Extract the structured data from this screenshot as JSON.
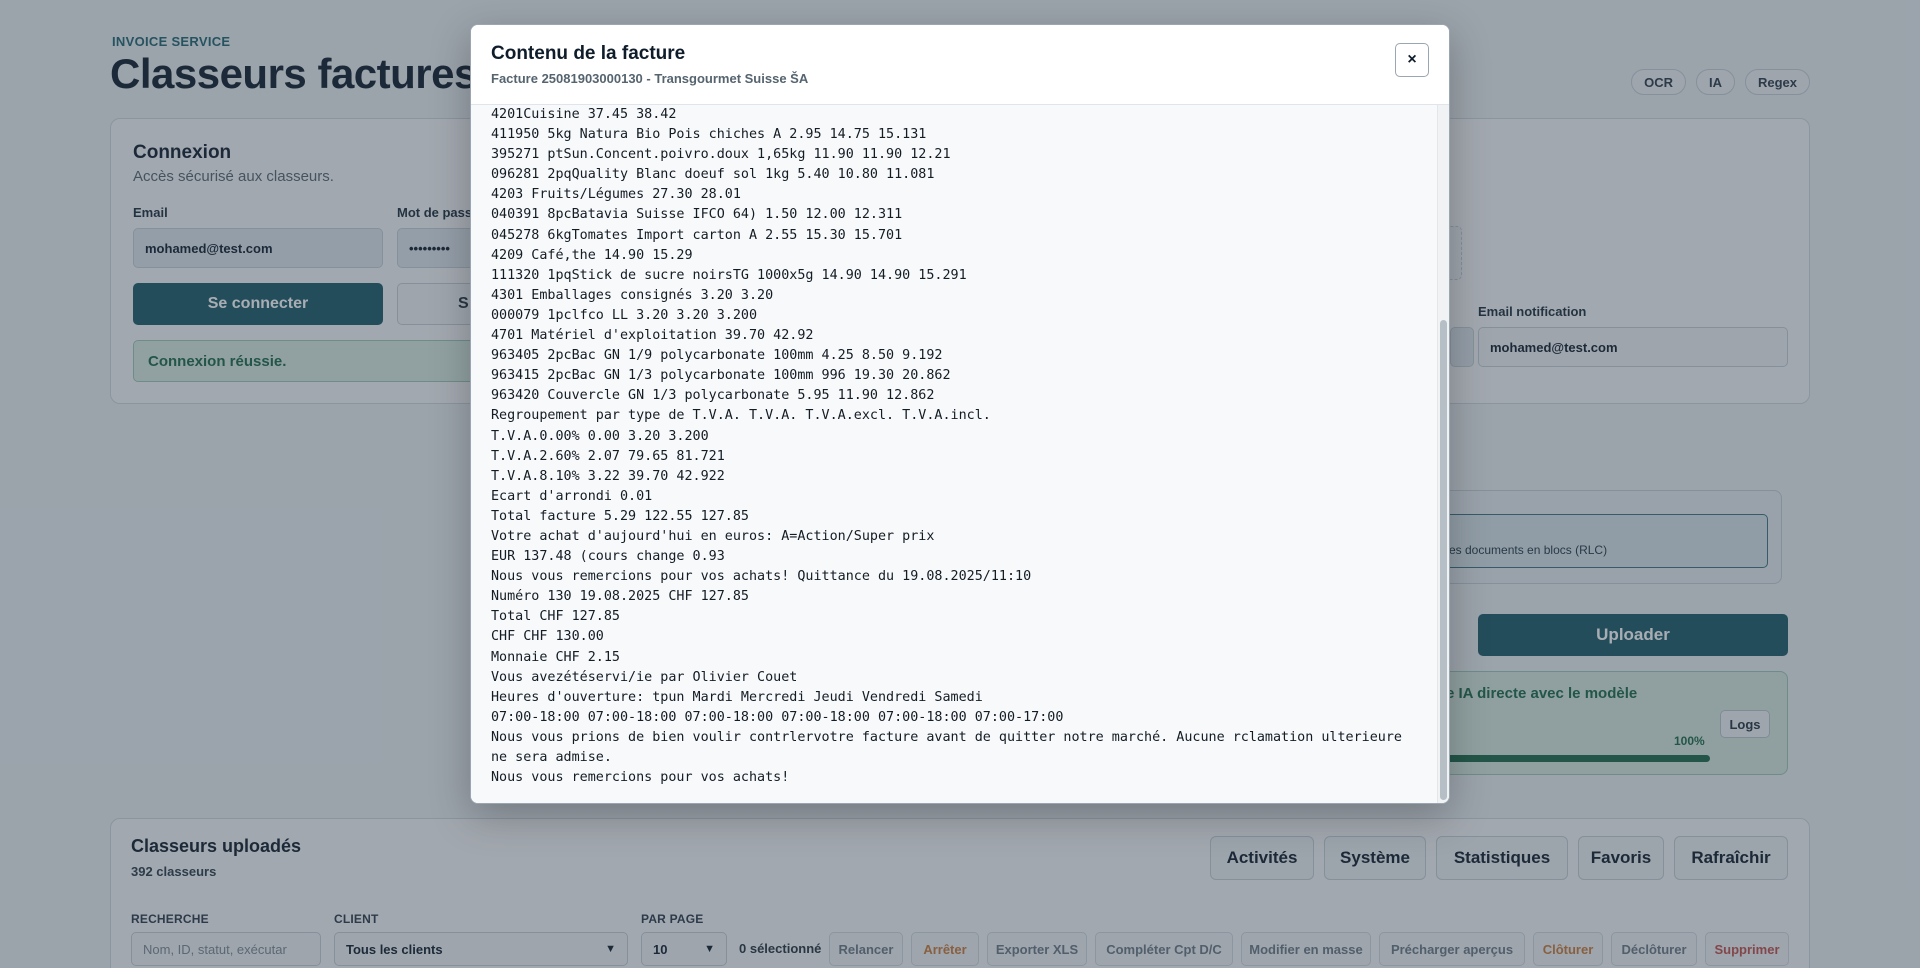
{
  "page": {
    "eyebrow": "INVOICE SERVICE",
    "title": "Classeurs factures",
    "chips": [
      "OCR",
      "IA",
      "Regex"
    ]
  },
  "login": {
    "title": "Connexion",
    "subtitle": "Accès sécurisé aux classeurs.",
    "email_label": "Email",
    "email_value": "mohamed@test.com",
    "password_label": "Mot de passe",
    "password_value": "•••••••••",
    "connect_label": "Se connecter",
    "ghost_label": "S",
    "success": "Connexion réussie."
  },
  "right_panel": {
    "email_notification_label": "Email notification",
    "email_notification_value": "mohamed@test.com",
    "rlc_text": "es documents en blocs (RLC)",
    "upload_label": "Uploader",
    "ai_text": "e IA directe avec le modèle",
    "logs_label": "Logs",
    "progress_percent": "100%",
    "progress_fraction": 1.0
  },
  "uploads": {
    "title": "Classeurs uploadés",
    "count": "392 classeurs",
    "buttons": [
      "Activités",
      "Système",
      "Statistiques",
      "Favoris",
      "Rafraîchir"
    ],
    "search_label": "RECHERCHE",
    "search_placeholder": "Nom, ID, statut, exécutar",
    "client_label": "CLIENT",
    "client_value": "Tous les clients",
    "per_page_label": "PAR PAGE",
    "per_page_value": "10",
    "selected_text": "0 sélectionné",
    "actions": [
      {
        "label": "Relancer",
        "tone": "grey"
      },
      {
        "label": "Arrêter",
        "tone": "orange"
      },
      {
        "label": "Exporter XLS",
        "tone": "grey"
      },
      {
        "label": "Compléter Cpt D/C",
        "tone": "grey"
      },
      {
        "label": "Modifier en masse",
        "tone": "grey"
      },
      {
        "label": "Précharger aperçus",
        "tone": "grey"
      },
      {
        "label": "Clôturer",
        "tone": "orange"
      },
      {
        "label": "Déclôturer",
        "tone": "grey"
      },
      {
        "label": "Supprimer",
        "tone": "red"
      }
    ]
  },
  "modal": {
    "title": "Contenu de la facture",
    "subtitle": "Facture 25081903000130 - Transgourmet Suisse ŠA",
    "close": "×",
    "lines": [
      "4201Cuisine 37.45 38.42",
      "411950 5kg Natura Bio Pois chiches A 2.95 14.75 15.131",
      "395271 ptSun.Concent.poivro.doux 1,65kg 11.90 11.90 12.21",
      "096281 2pqQuality Blanc doeuf sol 1kg 5.40 10.80 11.081",
      "4203 Fruits/Légumes 27.30 28.01",
      "040391 8pcBatavia Suisse IFCO 64) 1.50 12.00 12.311",
      "045278 6kgTomates Import carton A 2.55 15.30 15.701",
      "4209 Café,the 14.90 15.29",
      "111320 1pqStick de sucre noirsTG 1000x5g 14.90 14.90 15.291",
      "4301 Emballages consignés 3.20 3.20",
      "000079 1pclfco LL 3.20 3.20 3.200",
      "4701 Matériel d'exploitation 39.70 42.92",
      "963405 2pcBac GN 1/9 polycarbonate 100mm 4.25 8.50 9.192",
      "963415 2pcBac GN 1/3 polycarbonate 100mm 996 19.30 20.862",
      "963420 Couvercle GN 1/3 polycarbonate 5.95 11.90 12.862",
      "Regroupement par type de T.V.A. T.V.A. T.V.A.excl. T.V.A.incl.",
      "T.V.A.0.00% 0.00 3.20 3.200",
      "T.V.A.2.60% 2.07 79.65 81.721",
      "T.V.A.8.10% 3.22 39.70 42.922",
      "Ecart d'arrondi 0.01",
      "Total facture 5.29 122.55 127.85",
      "Votre achat d'aujourd'hui en euros: A=Action/Super prix",
      "EUR 137.48 (cours change 0.93",
      "Nous vous remercions pour vos achats! Quittance du 19.08.2025/11:10",
      "Numéro 130 19.08.2025 CHF 127.85",
      "Total CHF 127.85",
      "CHF CHF 130.00",
      "Monnaie CHF 2.15",
      "Vous avezétéservi/ie par Olivier Couet",
      "Heures d'ouverture: tpun Mardi Mercredi Jeudi Vendredi Samedi",
      "07:00-18:00 07:00-18:00 07:00-18:00 07:00-18:00 07:00-18:00 07:00-17:00",
      "Nous vous prions de bien voulir contrlervotre facture avant de quitter notre marché. Aucune rclamation ulterieure ne sera admise.",
      "Nous vous remercions pour vos achats!"
    ]
  }
}
